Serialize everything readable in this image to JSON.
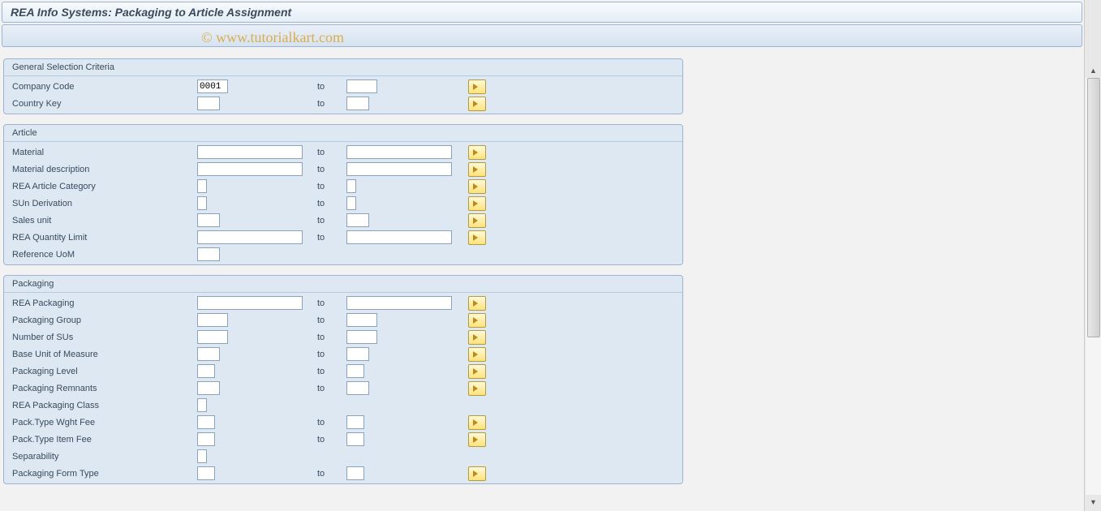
{
  "header": {
    "title": "REA Info Systems: Packaging to Article Assignment"
  },
  "watermark": "© www.tutorialkart.com",
  "groups": {
    "general": {
      "title": "General Selection Criteria",
      "rows": {
        "company_code": {
          "label": "Company Code",
          "from": "0001",
          "to_label": "to",
          "to": ""
        },
        "country_key": {
          "label": "Country Key",
          "from": "",
          "to_label": "to",
          "to": ""
        }
      }
    },
    "article": {
      "title": "Article",
      "rows": {
        "material": {
          "label": "Material",
          "from": "",
          "to_label": "to",
          "to": ""
        },
        "material_desc": {
          "label": "Material description",
          "from": "",
          "to_label": "to",
          "to": ""
        },
        "rea_article_cat": {
          "label": "REA Article Category",
          "from": "",
          "to_label": "to",
          "to": ""
        },
        "sun_derivation": {
          "label": "SUn Derivation",
          "from": "",
          "to_label": "to",
          "to": ""
        },
        "sales_unit": {
          "label": "Sales unit",
          "from": "",
          "to_label": "to",
          "to": ""
        },
        "rea_qty_limit": {
          "label": "REA Quantity Limit",
          "from": "",
          "to_label": "to",
          "to": ""
        },
        "reference_uom": {
          "label": "Reference UoM",
          "from": ""
        }
      }
    },
    "packaging": {
      "title": "Packaging",
      "rows": {
        "rea_packaging": {
          "label": "REA Packaging",
          "from": "",
          "to_label": "to",
          "to": ""
        },
        "packaging_group": {
          "label": "Packaging Group",
          "from": "",
          "to_label": "to",
          "to": ""
        },
        "number_of_sus": {
          "label": "Number of SUs",
          "from": "",
          "to_label": "to",
          "to": ""
        },
        "base_uom": {
          "label": "Base Unit of Measure",
          "from": "",
          "to_label": "to",
          "to": ""
        },
        "packaging_level": {
          "label": "Packaging Level",
          "from": "",
          "to_label": "to",
          "to": ""
        },
        "packaging_remn": {
          "label": "Packaging Remnants",
          "from": "",
          "to_label": "to",
          "to": ""
        },
        "rea_pack_class": {
          "label": "REA Packaging Class",
          "from": ""
        },
        "pack_type_wght": {
          "label": "Pack.Type Wght Fee",
          "from": "",
          "to_label": "to",
          "to": ""
        },
        "pack_type_item": {
          "label": "Pack.Type Item Fee",
          "from": "",
          "to_label": "to",
          "to": ""
        },
        "separability": {
          "label": "Separability",
          "from": ""
        },
        "packaging_form": {
          "label": "Packaging Form Type",
          "from": "",
          "to_label": "to",
          "to": ""
        }
      }
    }
  }
}
